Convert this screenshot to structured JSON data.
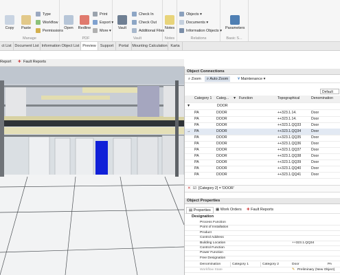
{
  "ribbon": {
    "manage": {
      "copy": "Copy",
      "paste": "Paste",
      "type": "Type",
      "workflow": "Workflow",
      "permissions": "Permissions",
      "group_label": "Manage"
    },
    "pdf": {
      "open": "Open",
      "redline": "Redline",
      "print": "Print",
      "export": "Export",
      "more": "More",
      "group_label": "PDF"
    },
    "vault": {
      "vault": "Vault",
      "check_in": "Check In",
      "check_out": "Check Out",
      "additional_files": "Additional Files",
      "group_label": "Vault"
    },
    "notes": {
      "notes": "Notes",
      "group_label": "Notes"
    },
    "relations": {
      "objects": "Objects",
      "documents": "Documents",
      "information_objects": "Information Objects",
      "group_label": "Relations"
    },
    "basic": {
      "parameters": "Parameters",
      "group_label": "Basic S..."
    }
  },
  "tabs": [
    {
      "label": "ct List"
    },
    {
      "label": "Document List"
    },
    {
      "label": "Information Object List"
    },
    {
      "label": "Preview"
    },
    {
      "label": "Support"
    },
    {
      "label": "Portal"
    },
    {
      "label": "Mounting Calculation"
    },
    {
      "label": "Karta"
    }
  ],
  "viewbar": {
    "report": "Report",
    "fault_reports": "Fault Reports"
  },
  "object_connections": {
    "title": "Object Connections",
    "zoom": "Zoom",
    "auto_zoom": "Auto Zoom",
    "maintenance": "Maintenance",
    "default": "Default",
    "columns": [
      "Category 1",
      "Categ...",
      "Function",
      "Topographical",
      "Denomination"
    ],
    "filter_value": "DOOR",
    "rows": [
      {
        "c1": "PA",
        "c2": "DOOR",
        "topo": "++323.1.14.",
        "den": "Door"
      },
      {
        "c1": "PA",
        "c2": "DOOR",
        "topo": "++323.1.14.",
        "den": "Door"
      },
      {
        "c1": "PA",
        "c2": "DOOR",
        "topo": "++323.1.QQ33",
        "den": "Door"
      },
      {
        "c1": "PA",
        "c2": "DOOR",
        "topo": "++323.1.QQ34",
        "den": "Door"
      },
      {
        "c1": "PA",
        "c2": "DOOR",
        "topo": "++323.1.QQ35",
        "den": "Door"
      },
      {
        "c1": "PA",
        "c2": "DOOR",
        "topo": "++323.1.QQ36",
        "den": "Door"
      },
      {
        "c1": "PA",
        "c2": "DOOR",
        "topo": "++323.1.QQ37",
        "den": "Door"
      },
      {
        "c1": "PA",
        "c2": "DOOR",
        "topo": "++323.1.QQ38",
        "den": "Door"
      },
      {
        "c1": "PA",
        "c2": "DOOR",
        "topo": "++323.1.QQ39",
        "den": "Door"
      },
      {
        "c1": "PA",
        "c2": "DOOR",
        "topo": "++323.1.QQ40",
        "den": "Door"
      },
      {
        "c1": "PA",
        "c2": "DOOR",
        "topo": "++323.1.QQ41",
        "den": "Door"
      }
    ],
    "filter_text": "[Category 2] = 'DOOR'"
  },
  "object_properties": {
    "title": "Object Properties",
    "tabs": [
      "Properties",
      "Work Orders",
      "Fault Reports"
    ],
    "section": "Designation",
    "rows": [
      {
        "label": "Process Function",
        "value": ""
      },
      {
        "label": "Point of Installation",
        "value": ""
      },
      {
        "label": "Product",
        "value": ""
      },
      {
        "label": "Control Address",
        "value": ""
      },
      {
        "label": "Building Location",
        "value": "++323.1.QQ34"
      },
      {
        "label": "Control Function",
        "value": ""
      },
      {
        "label": "Power Function",
        "value": ""
      },
      {
        "label": "Free Designation",
        "value": ""
      }
    ],
    "denomination_label": "Denomination",
    "category1": "Category 1",
    "category2": "Category 2",
    "denomination_value": "Door",
    "pa_value": "PA",
    "workflow_label": "Workflow State",
    "workflow_value": "Preliminary (New Object)"
  },
  "colors": {
    "accent": "#2e6fb5",
    "door_blue": "#1020d8"
  }
}
